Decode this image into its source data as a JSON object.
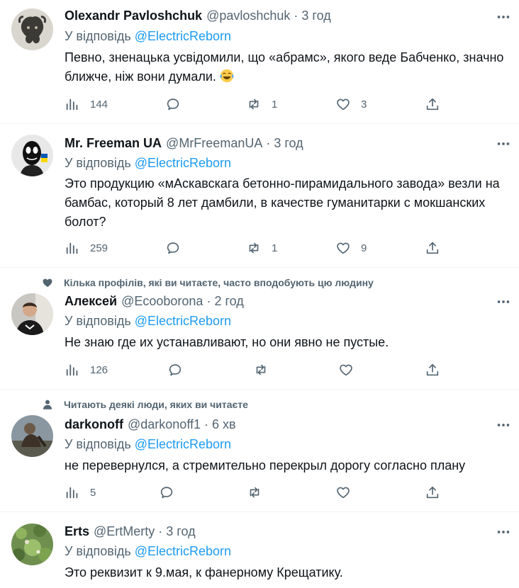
{
  "common": {
    "reply_prefix": "У відповідь",
    "reply_mention": "@ElectricReborn",
    "dot": "·"
  },
  "tweets": [
    {
      "name": "Olexandr Pavloshchuk",
      "handle": "@pavloshchuk",
      "time": "3 год",
      "social_context": "",
      "text": "Певно, зненацька усвідомили, що «абрамс», якого веде Бабченко, значно ближче, ніж вони думали.",
      "emoji": "face-with-tears-of-joy",
      "views": "144",
      "replies": "",
      "retweets": "1",
      "likes": "3"
    },
    {
      "name": "Mr. Freeman UA",
      "handle": "@MrFreemanUA",
      "time": "3 год",
      "social_context": "",
      "text": "Это продукцию «мАскавскага бетонно-пирамидального завода» везли на бамбас, который 8 лет дамбили, в качестве гуманитарки с мокшанских болот?",
      "views": "259",
      "replies": "",
      "retweets": "1",
      "likes": "9"
    },
    {
      "name": "Алексей",
      "handle": "@Ecooborona",
      "time": "2 год",
      "social_context": "Кілька профілів, які ви читаєте, часто вподобують цю людину",
      "text": "Не знаю где их устанавливают, но они явно не пустые.",
      "views": "126",
      "replies": "",
      "retweets": "",
      "likes": ""
    },
    {
      "name": "darkonoff",
      "handle": "@darkonoff1",
      "time": "6 хв",
      "social_context": "Читають деякі люди, яких ви читаєте",
      "text": "не перевернулся, а стремительно перекрыл дорогу согласно плану",
      "views": "5",
      "replies": "",
      "retweets": "",
      "likes": ""
    },
    {
      "name": "Erts",
      "handle": "@ErtMerty",
      "time": "3 год",
      "social_context": "",
      "text": "Это реквизит к 9.мая, к фанерному Крещатику.",
      "views": "",
      "replies": "",
      "retweets": "",
      "likes": ""
    }
  ],
  "colors": {
    "accent": "#1d9bf0",
    "secondary_text": "#536471",
    "primary_text": "#0f1419",
    "divider": "#eff3f4"
  },
  "icons": {
    "more": "more-horizontal-icon",
    "views": "views-chart-icon",
    "reply": "reply-bubble-icon",
    "retweet": "retweet-icon",
    "like": "heart-icon",
    "share": "share-upload-icon",
    "social_like": "heart-filled-icon",
    "social_person": "person-icon"
  }
}
